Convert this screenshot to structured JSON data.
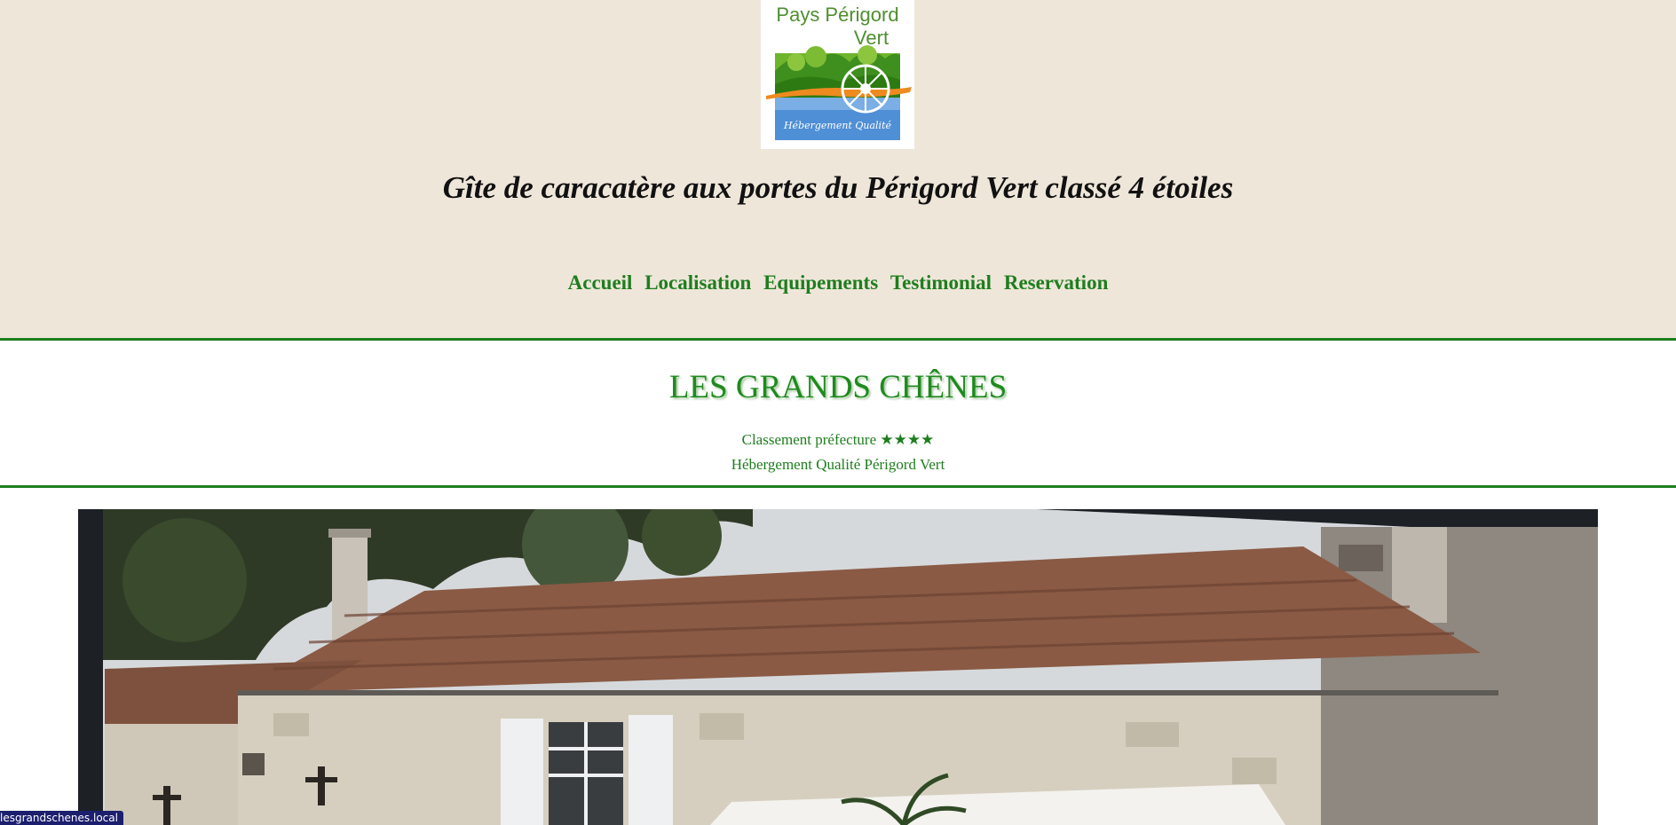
{
  "logo": {
    "line1": "Pays Périgord",
    "line2": "Vert",
    "subtitle": "Hébergement Qualité"
  },
  "tagline": "Gîte de caracatère aux portes du Périgord Vert classé 4 étoiles",
  "nav": {
    "items": [
      "Accueil",
      "Localisation",
      "Equipements",
      "Testimonial",
      "Reservation"
    ]
  },
  "site": {
    "title": "LES GRANDS CHÊNES",
    "classement": "Classement préfecture ★★★★",
    "label": "Hébergement Qualité Périgord Vert"
  },
  "hero": {
    "description": "photo-of-stone-house-with-tiled-roof"
  },
  "status_bar": {
    "url": "lesgrandschenes.local"
  },
  "colors": {
    "band_background": "#efe6da",
    "accent_green": "#1e7e1e",
    "title_green": "#1e8a1e",
    "status_blue": "#1c1f6e"
  }
}
